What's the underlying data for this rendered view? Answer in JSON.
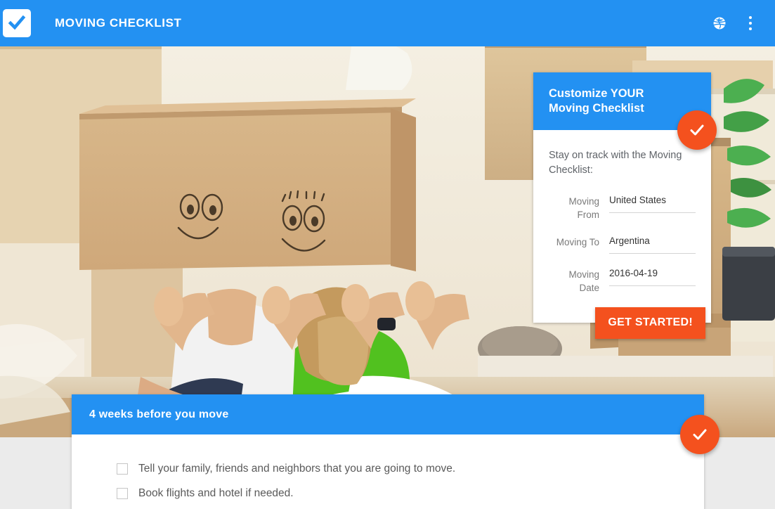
{
  "appbar": {
    "logo_icon": "checkbox-check-icon",
    "title": "MOVING CHECKLIST",
    "language_icon": "globe-icon",
    "overflow_icon": "more-vertical-icon"
  },
  "hero": {
    "alt": "Couple sitting among moving boxes holding a cardboard box with drawn smiley faces over their heads"
  },
  "customize_card": {
    "title": "Customize YOUR Moving Checklist",
    "fab_icon": "check-icon",
    "intro": "Stay on track with the Moving Checklist:",
    "fields": [
      {
        "label": "Moving From",
        "value": "United States",
        "placeholder": ""
      },
      {
        "label": "Moving To",
        "value": "Argentina",
        "placeholder": ""
      },
      {
        "label": "Moving Date",
        "value": "2016-04-19",
        "placeholder": ""
      }
    ],
    "cta_label": "GET STARTED!"
  },
  "checklist_card": {
    "title": "4 weeks before you move",
    "fab_icon": "check-icon",
    "items": [
      {
        "label": "Tell your family, friends and neighbors that you are going to move.",
        "checked": false
      },
      {
        "label": "Book flights and hotel if needed.",
        "checked": false
      }
    ]
  },
  "colors": {
    "primary_blue": "#2391f2",
    "accent_orange": "#f4511e",
    "page_background": "#ebebeb",
    "card_background": "#ffffff",
    "label_gray": "#7a7a7a",
    "value_gray": "#333333",
    "body_gray": "#5a5a5a"
  }
}
